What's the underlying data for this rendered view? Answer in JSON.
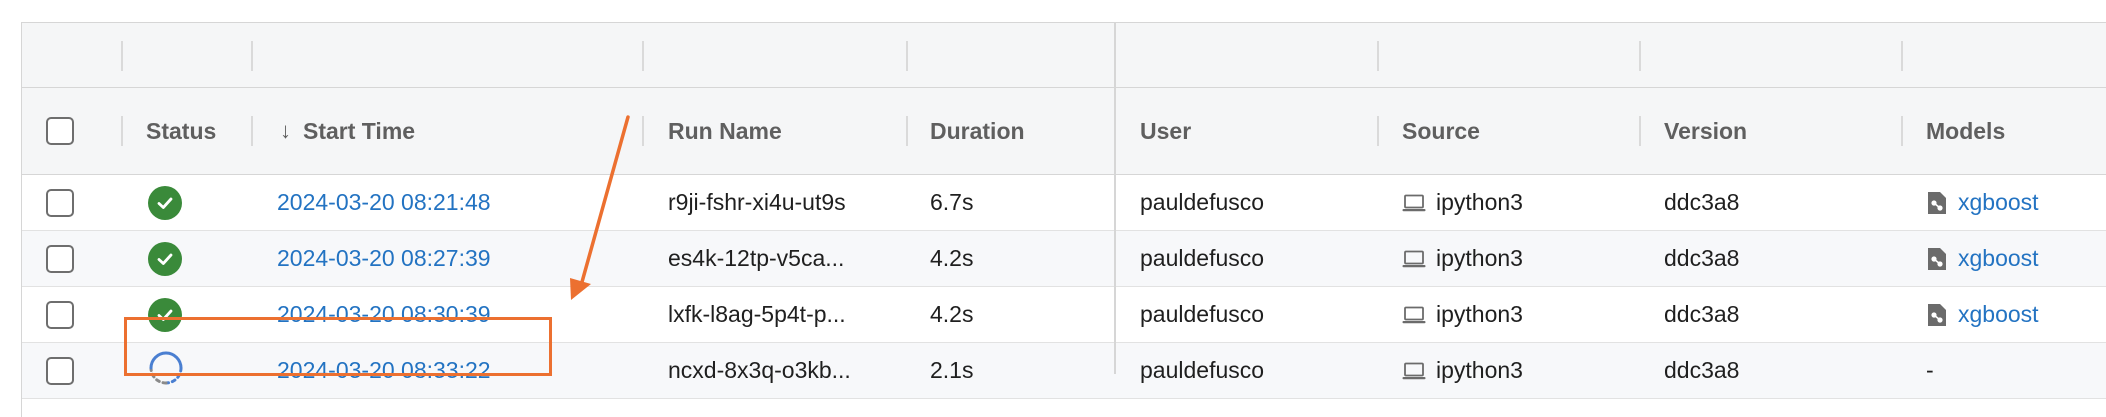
{
  "columns": {
    "status": "Status",
    "start_time": "Start Time",
    "sort_indicator": "↓",
    "run_name": "Run Name",
    "duration": "Duration",
    "user": "User",
    "source": "Source",
    "version": "Version",
    "models": "Models"
  },
  "rows": [
    {
      "status": "finished",
      "start_time": "2024-03-20 08:21:48",
      "run_name": "r9ji-fshr-xi4u-ut9s",
      "duration": "6.7s",
      "user": "pauldefusco",
      "source": "ipython3",
      "version": "ddc3a8",
      "model": "xgboost"
    },
    {
      "status": "finished",
      "start_time": "2024-03-20 08:27:39",
      "run_name": "es4k-12tp-v5ca...",
      "duration": "4.2s",
      "user": "pauldefusco",
      "source": "ipython3",
      "version": "ddc3a8",
      "model": "xgboost"
    },
    {
      "status": "finished",
      "start_time": "2024-03-20 08:30:39",
      "run_name": "lxfk-l8ag-5p4t-p...",
      "duration": "4.2s",
      "user": "pauldefusco",
      "source": "ipython3",
      "version": "ddc3a8",
      "model": "xgboost"
    },
    {
      "status": "running",
      "start_time": "2024-03-20 08:33:22",
      "run_name": "ncxd-8x3q-o3kb...",
      "duration": "2.1s",
      "user": "pauldefusco",
      "source": "ipython3",
      "version": "ddc3a8",
      "model": "-"
    }
  ],
  "icons": {
    "status_finished": "check-circle-icon",
    "status_running": "spinner-icon",
    "source": "laptop-icon",
    "model": "model-registry-icon"
  },
  "colors": {
    "link": "#2373c2",
    "success": "#3a8a3a",
    "running": "#4a7fd1",
    "annotation": "#ec7030"
  }
}
